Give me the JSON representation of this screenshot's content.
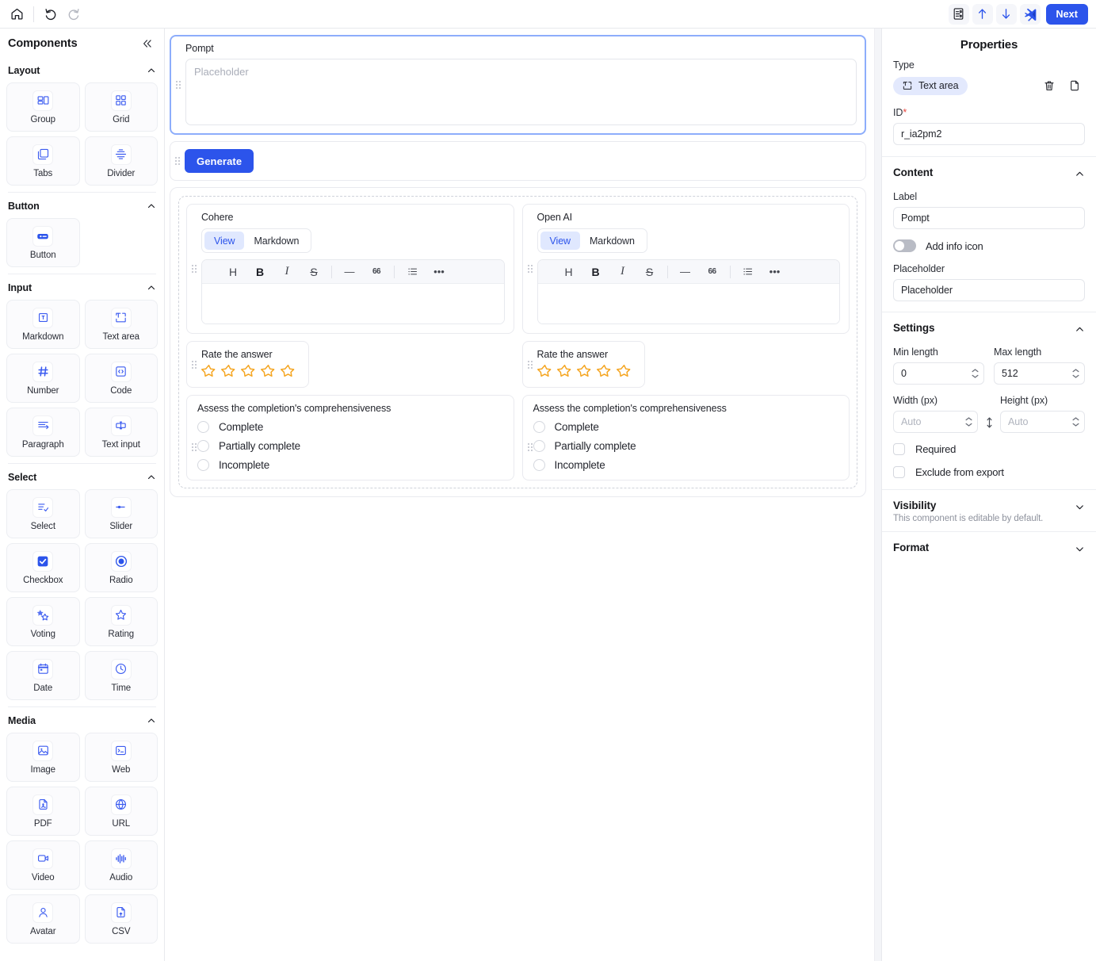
{
  "topbar": {
    "icons_left": [
      {
        "name": "home-icon",
        "label": "Home"
      },
      {
        "name": "undo-icon",
        "label": "Undo"
      },
      {
        "name": "redo-icon",
        "label": "Redo"
      }
    ],
    "icons_right": [
      {
        "name": "form-preview-icon",
        "label": "Form preview"
      },
      {
        "name": "upload-icon",
        "label": "Upload"
      },
      {
        "name": "download-icon",
        "label": "Download"
      },
      {
        "name": "vscode-icon",
        "label": "Open in code editor"
      }
    ],
    "next_label": "Next",
    "accent_color": "#2c54eb"
  },
  "sidebar": {
    "title": "Components",
    "collapse_icon": "chevrons-left-icon",
    "groups": [
      {
        "label": "Layout",
        "expanded": true,
        "items": [
          {
            "label": "Group",
            "icon": "group-icon"
          },
          {
            "label": "Grid",
            "icon": "grid-icon"
          },
          {
            "label": "Tabs",
            "icon": "tabs-icon"
          },
          {
            "label": "Divider",
            "icon": "divider-icon"
          }
        ]
      },
      {
        "label": "Button",
        "expanded": true,
        "items": [
          {
            "label": "Button",
            "icon": "button-icon"
          }
        ]
      },
      {
        "label": "Input",
        "expanded": true,
        "items": [
          {
            "label": "Markdown",
            "icon": "markdown-icon"
          },
          {
            "label": "Text area",
            "icon": "text-area-icon"
          },
          {
            "label": "Number",
            "icon": "number-hash-icon"
          },
          {
            "label": "Code",
            "icon": "code-icon"
          },
          {
            "label": "Paragraph",
            "icon": "paragraph-icon"
          },
          {
            "label": "Text input",
            "icon": "text-input-icon"
          }
        ]
      },
      {
        "label": "Select",
        "expanded": true,
        "items": [
          {
            "label": "Select",
            "icon": "select-list-icon"
          },
          {
            "label": "Slider",
            "icon": "slider-icon"
          },
          {
            "label": "Checkbox",
            "icon": "checkbox-icon"
          },
          {
            "label": "Radio",
            "icon": "radio-icon"
          },
          {
            "label": "Voting",
            "icon": "voting-icon"
          },
          {
            "label": "Rating",
            "icon": "star-icon"
          },
          {
            "label": "Date",
            "icon": "calendar-icon"
          },
          {
            "label": "Time",
            "icon": "clock-icon"
          }
        ]
      },
      {
        "label": "Media",
        "expanded": true,
        "items": [
          {
            "label": "Image",
            "icon": "image-icon"
          },
          {
            "label": "Web",
            "icon": "terminal-icon"
          },
          {
            "label": "PDF",
            "icon": "pdf-file-icon"
          },
          {
            "label": "URL",
            "icon": "globe-icon"
          },
          {
            "label": "Video",
            "icon": "video-camera-icon"
          },
          {
            "label": "Audio",
            "icon": "audio-waveform-icon"
          },
          {
            "label": "Avatar",
            "icon": "avatar-person-icon"
          },
          {
            "label": "CSV",
            "icon": "csv-upload-icon"
          }
        ]
      }
    ]
  },
  "canvas": {
    "prompt_block": {
      "label": "Pompt",
      "placeholder": "Placeholder",
      "value": "",
      "selected": true
    },
    "generate_block": {
      "button_label": "Generate"
    },
    "columns": [
      {
        "title": "Cohere",
        "segmented": {
          "options": [
            "View",
            "Markdown"
          ],
          "selected": "View"
        },
        "markdown_toolbar": [
          {
            "name": "heading-icon",
            "glyph": "H"
          },
          {
            "name": "bold-icon",
            "glyph": "B"
          },
          {
            "name": "italic-icon",
            "glyph": "I"
          },
          {
            "name": "strikethrough-icon",
            "glyph": "S"
          },
          {
            "name": "horizontal-rule-icon",
            "glyph": "—"
          },
          {
            "name": "quote-icon",
            "glyph": "66"
          },
          {
            "name": "bullet-list-icon",
            "glyph": "list"
          },
          {
            "name": "more-options-icon",
            "glyph": "•••"
          }
        ],
        "editor_value": "",
        "rating": {
          "label": "Rate the answer",
          "max": 5,
          "value": 0,
          "color": "#f5a623"
        },
        "radio_group": {
          "label": "Assess the completion's comprehensiveness",
          "options": [
            "Complete",
            "Partially complete",
            "Incomplete"
          ],
          "selected": null
        }
      },
      {
        "title": "Open AI",
        "segmented": {
          "options": [
            "View",
            "Markdown"
          ],
          "selected": "View"
        },
        "markdown_toolbar": [
          {
            "name": "heading-icon",
            "glyph": "H"
          },
          {
            "name": "bold-icon",
            "glyph": "B"
          },
          {
            "name": "italic-icon",
            "glyph": "I"
          },
          {
            "name": "strikethrough-icon",
            "glyph": "S"
          },
          {
            "name": "horizontal-rule-icon",
            "glyph": "—"
          },
          {
            "name": "quote-icon",
            "glyph": "66"
          },
          {
            "name": "bullet-list-icon",
            "glyph": "list"
          },
          {
            "name": "more-options-icon",
            "glyph": "•••"
          }
        ],
        "editor_value": "",
        "rating": {
          "label": "Rate the answer",
          "max": 5,
          "value": 0,
          "color": "#f5a623"
        },
        "radio_group": {
          "label": "Assess the completion's comprehensiveness",
          "options": [
            "Complete",
            "Partially complete",
            "Incomplete"
          ],
          "selected": null
        }
      }
    ]
  },
  "properties": {
    "title": "Properties",
    "type": {
      "label": "Type",
      "chip_label": "Text area",
      "chip_icon": "text-area-icon",
      "delete_icon": "trash-icon",
      "duplicate_icon": "copy-icon"
    },
    "id": {
      "label": "ID",
      "required_marker": "*",
      "value": "r_ia2pm2"
    },
    "content": {
      "title": "Content",
      "expanded": true,
      "label_field": {
        "label": "Label",
        "value": "Pompt"
      },
      "info_toggle": {
        "label": "Add info icon",
        "on": false
      },
      "placeholder_field": {
        "label": "Placeholder",
        "value": "Placeholder"
      }
    },
    "settings": {
      "title": "Settings",
      "expanded": true,
      "min_length": {
        "label": "Min length",
        "value": "0"
      },
      "max_length": {
        "label": "Max length",
        "value": "512"
      },
      "width": {
        "label": "Width (px)",
        "value": "",
        "placeholder": "Auto"
      },
      "height": {
        "label": "Height (px)",
        "value": "",
        "placeholder": "Auto"
      },
      "link_icon": "link-dimensions-icon",
      "required": {
        "label": "Required",
        "checked": false
      },
      "exclude": {
        "label": "Exclude from export",
        "checked": false
      }
    },
    "visibility": {
      "title": "Visibility",
      "subtitle": "This component is editable by default.",
      "expanded": false
    },
    "format": {
      "title": "Format",
      "expanded": false
    }
  }
}
